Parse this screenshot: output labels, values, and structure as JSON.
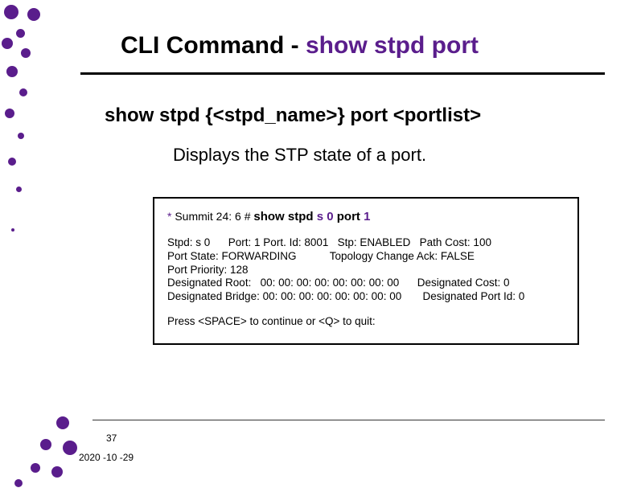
{
  "title": {
    "prefix": "CLI Command - ",
    "highlight": "show stpd port"
  },
  "syntax": "show stpd {<stpd_name>} port <portlist>",
  "description": "Displays the STP state of a port.",
  "terminal": {
    "prompt_star": "*",
    "prompt": " Summit 24: 6 # ",
    "cmd_base": "show stpd ",
    "cmd_arg1": "s 0",
    "cmd_mid": " port ",
    "cmd_arg2": "1",
    "out1": "Stpd: s 0      Port: 1 Port. Id: 8001   Stp: ENABLED   Path Cost: 100",
    "out2": "Port State: FORWARDING           Topology Change Ack: FALSE",
    "out3": "Port Priority: 128",
    "out4": "Designated Root:   00: 00: 00: 00: 00: 00: 00: 00      Designated Cost: 0",
    "out5": "Designated Bridge: 00: 00: 00: 00: 00: 00: 00: 00       Designated Port Id: 0",
    "quit": "Press <SPACE> to continue or <Q> to quit:"
  },
  "footer": {
    "slide_number": "37",
    "date": "2020 -10 -29"
  },
  "colors": {
    "accent": "#5a1d8c"
  }
}
